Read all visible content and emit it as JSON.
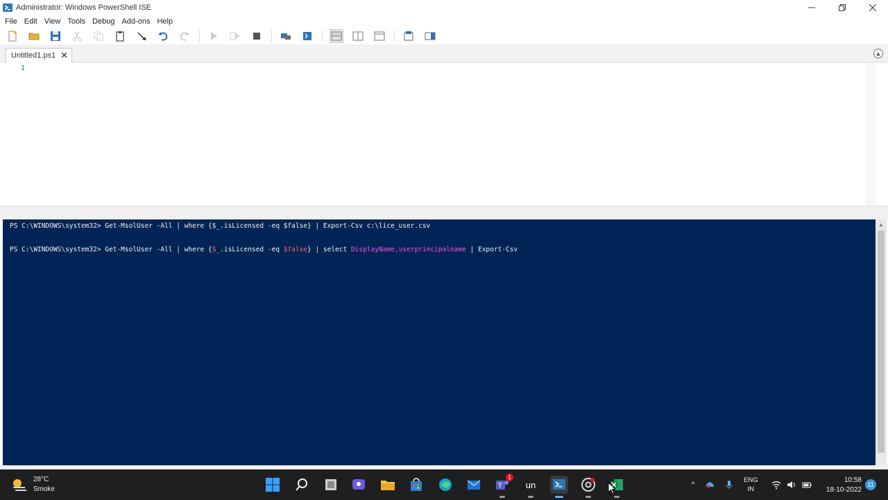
{
  "window": {
    "title": "Administrator: Windows PowerShell ISE"
  },
  "menu": {
    "file": "File",
    "edit": "Edit",
    "view": "View",
    "tools": "Tools",
    "debug": "Debug",
    "addons": "Add-ons",
    "help": "Help"
  },
  "tabs": [
    {
      "label": "Untitled1.ps1"
    }
  ],
  "editor": {
    "line_numbers": [
      "1"
    ]
  },
  "console": {
    "line1": {
      "prompt": "PS C:\\WINDOWS\\system32> ",
      "text": "Get-MsolUser -All | where {$_.isLicensed -eq $false} | Export-Csv c:\\lice_user.csv"
    },
    "line2": {
      "prompt": "PS C:\\WINDOWS\\system32> ",
      "cmd": "Get-MsolUser -All | where {",
      "var1": "$_",
      "mid1": ".isLicensed -eq ",
      "var2": "$false",
      "mid2": "} | select ",
      "members": "DisplayName,userprincipalname",
      "tail": " | Export-Csv"
    }
  },
  "taskbar": {
    "weather": {
      "temp": "28°C",
      "condition": "Smoke"
    },
    "text_app": "un",
    "teams_badge": "1",
    "lang": {
      "line1": "ENG",
      "line2": "IN"
    },
    "clock": {
      "time": "10:58",
      "date": "18-10-2022"
    },
    "notification_count": "11"
  },
  "colors": {
    "console_bg": "#012456",
    "taskbar_bg": "#1f1f1f",
    "accent": "#5fb2ff"
  }
}
